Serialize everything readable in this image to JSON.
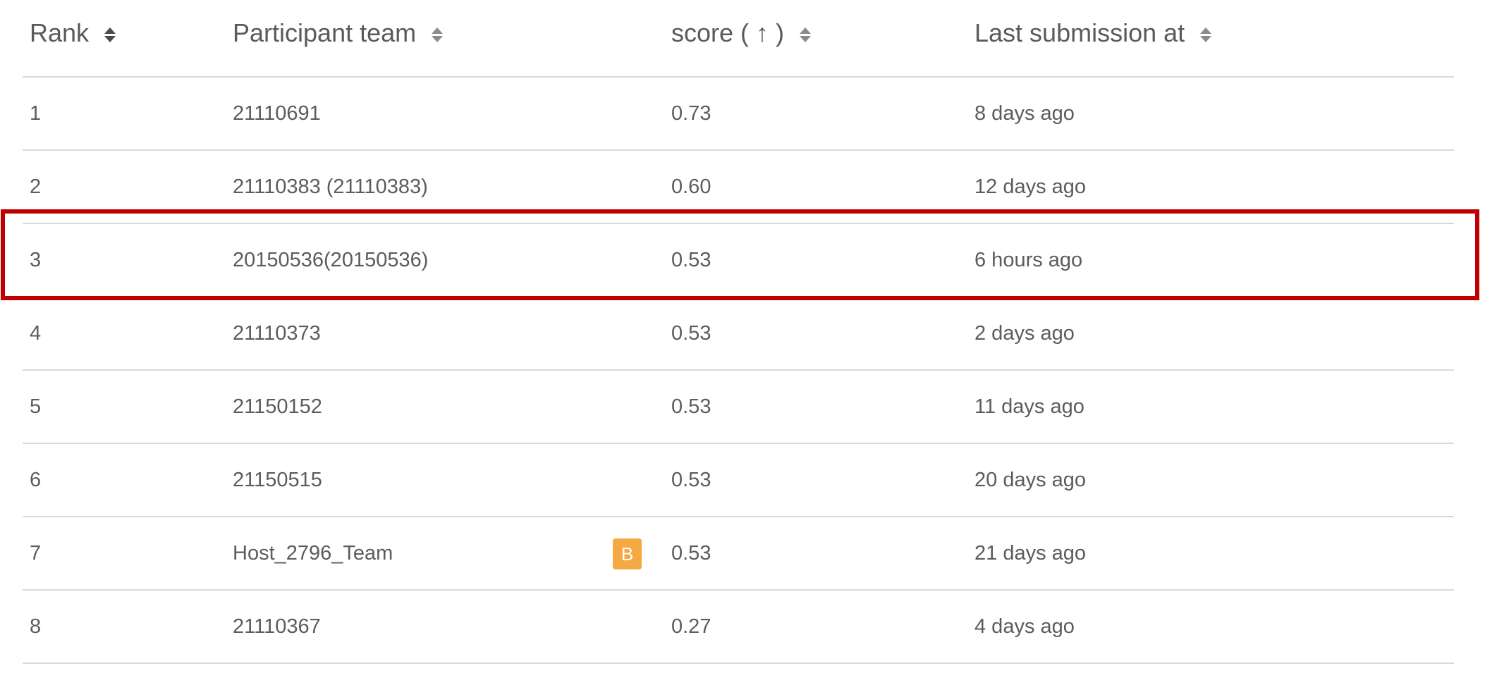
{
  "table": {
    "headers": {
      "rank": "Rank",
      "team": "Participant team",
      "score": "score ( ↑ )",
      "time": "Last submission at"
    },
    "rows": [
      {
        "rank": "1",
        "team": "21110691",
        "score": "0.73",
        "time": "8 days ago",
        "badge": ""
      },
      {
        "rank": "2",
        "team": "21110383 (21110383)",
        "score": "0.60",
        "time": "12 days ago",
        "badge": ""
      },
      {
        "rank": "3",
        "team": "20150536(20150536)",
        "score": "0.53",
        "time": "6 hours ago",
        "badge": ""
      },
      {
        "rank": "4",
        "team": "21110373",
        "score": "0.53",
        "time": "2 days ago",
        "badge": ""
      },
      {
        "rank": "5",
        "team": "21150152",
        "score": "0.53",
        "time": "11 days ago",
        "badge": ""
      },
      {
        "rank": "6",
        "team": "21150515",
        "score": "0.53",
        "time": "20 days ago",
        "badge": ""
      },
      {
        "rank": "7",
        "team": "Host_2796_Team",
        "score": "0.53",
        "time": "21 days ago",
        "badge": "B"
      },
      {
        "rank": "8",
        "team": "21110367",
        "score": "0.27",
        "time": "4 days ago",
        "badge": ""
      }
    ]
  },
  "icons": {
    "sort": "sort-icon",
    "baseline_badge": "badge-icon"
  },
  "colors": {
    "highlight": "#c00000",
    "badge": "#f5a942",
    "divider": "#d9d9d9"
  }
}
